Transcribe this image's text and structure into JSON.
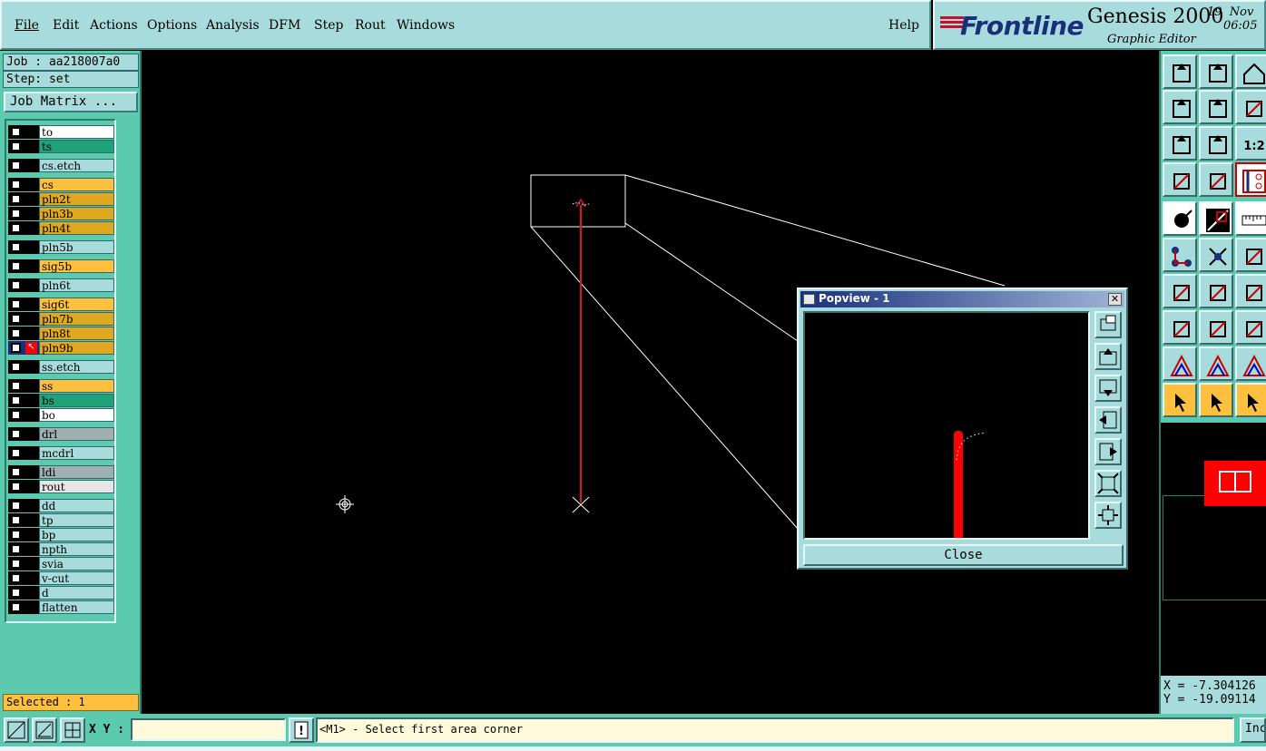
{
  "menu": {
    "items": [
      {
        "label": "File"
      },
      {
        "label": "Edit"
      },
      {
        "label": "Actions"
      },
      {
        "label": "Options"
      },
      {
        "label": "Analysis"
      },
      {
        "label": "DFM"
      },
      {
        "label": "Step"
      },
      {
        "label": "Rout"
      },
      {
        "label": "Windows"
      }
    ],
    "help": "Help"
  },
  "brand": {
    "logo": "Frontline",
    "product": "Genesis 2000",
    "subtitle": "Graphic Editor",
    "date_line1": "19  Nov",
    "date_line2": "06:05"
  },
  "job": {
    "job_line": "Job : aa218007a0",
    "step_line": "Step: set",
    "matrix_button": "Job Matrix ..."
  },
  "layers": [
    {
      "name": "to",
      "color": "#ffffff"
    },
    {
      "name": "ts",
      "color": "#1fa17a"
    },
    {
      "name": "cs.etch",
      "color": "#a8dcdc"
    },
    {
      "name": "cs",
      "color": "#ffc040"
    },
    {
      "name": "pln2t",
      "color": "#e0a820"
    },
    {
      "name": "pln3b",
      "color": "#e0a820"
    },
    {
      "name": "pln4t",
      "color": "#e0a820"
    },
    {
      "name": "pln5b",
      "color": "#a8dcdc"
    },
    {
      "name": "sig5b",
      "color": "#ffc040"
    },
    {
      "name": "pln6t",
      "color": "#a8dcdc"
    },
    {
      "name": "sig6t",
      "color": "#ffc040"
    },
    {
      "name": "pln7b",
      "color": "#e0a820"
    },
    {
      "name": "pln8t",
      "color": "#e0a820"
    },
    {
      "name": "pln9b",
      "color": "#e0a820",
      "work": true
    },
    {
      "name": "ss.etch",
      "color": "#a8dcdc"
    },
    {
      "name": "ss",
      "color": "#ffc040"
    },
    {
      "name": "bs",
      "color": "#1fa17a"
    },
    {
      "name": "bo",
      "color": "#ffffff"
    },
    {
      "name": "drl",
      "color": "#9fb0b0"
    },
    {
      "name": "mcdrl",
      "color": "#a8dcdc"
    },
    {
      "name": "ldi",
      "color": "#9fb0b0"
    },
    {
      "name": "rout",
      "color": "#e6e6e6"
    },
    {
      "name": "dd",
      "color": "#a8dcdc"
    },
    {
      "name": "tp",
      "color": "#a8dcdc"
    },
    {
      "name": "bp",
      "color": "#a8dcdc"
    },
    {
      "name": "npth",
      "color": "#a8dcdc"
    },
    {
      "name": "svia",
      "color": "#a8dcdc"
    },
    {
      "name": "v-cut",
      "color": "#a8dcdc"
    },
    {
      "name": "d",
      "color": "#a8dcdc"
    },
    {
      "name": "flatten",
      "color": "#a8dcdc"
    }
  ],
  "status": {
    "selected": "Selected : 1"
  },
  "popview": {
    "title": "Popview - 1",
    "close_label": "Close"
  },
  "coords": {
    "x": "X = -7.304126",
    "y": "Y = -19.09114"
  },
  "bottom": {
    "xy_label": "X Y :",
    "xy_value": "",
    "prompt": "<M1> - Select first area corner",
    "inc_label": "Inc"
  },
  "colors": {
    "panel": "#a8dcdc",
    "accent_teal": "#5ccaaf",
    "highlight": "#ff0000",
    "brand_blue": "#1a2f7a"
  }
}
